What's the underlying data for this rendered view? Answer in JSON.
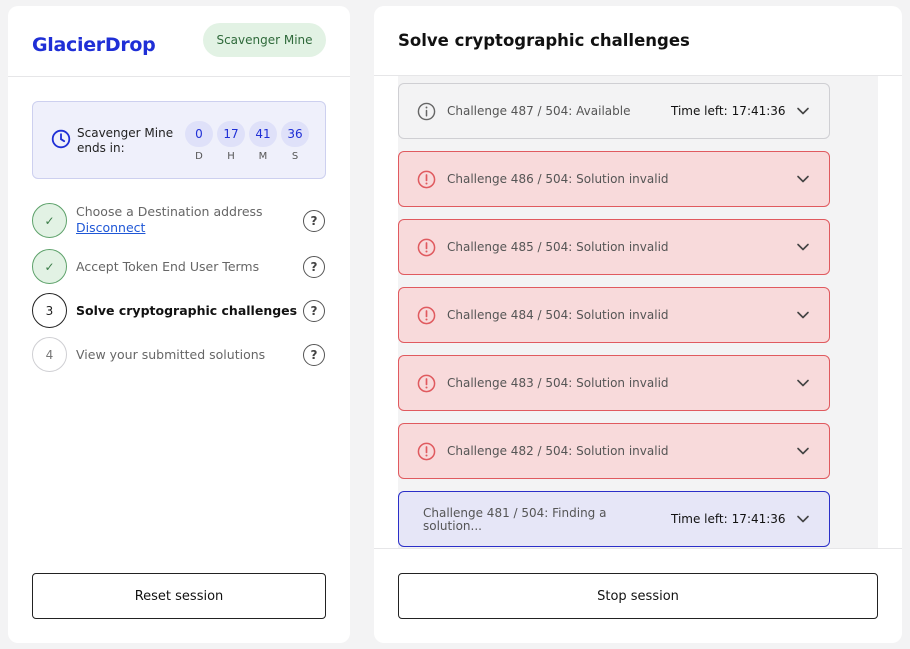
{
  "app": {
    "logo": "GlacierDrop",
    "badge": "Scavenger Mine"
  },
  "timer": {
    "label": "Scavenger Mine ends in:",
    "units": [
      {
        "value": "0",
        "unit": "D"
      },
      {
        "value": "17",
        "unit": "H"
      },
      {
        "value": "41",
        "unit": "M"
      },
      {
        "value": "36",
        "unit": "S"
      }
    ]
  },
  "steps": [
    {
      "number": "",
      "label": "Choose a Destination address",
      "link": "Disconnect",
      "status": "done"
    },
    {
      "number": "",
      "label": "Accept Token End User Terms",
      "status": "done"
    },
    {
      "number": "3",
      "label": "Solve cryptographic challenges",
      "status": "active"
    },
    {
      "number": "4",
      "label": "View your submitted solutions",
      "status": "todo"
    }
  ],
  "help_glyph": "?",
  "check_glyph": "✓",
  "reset_label": "Reset session",
  "main": {
    "title": "Solve cryptographic challenges",
    "time_left_label": "Time left:",
    "challenges": [
      {
        "label": "Challenge 487 / 504: Available",
        "status": "available",
        "time_left": "17:41:36"
      },
      {
        "label": "Challenge 486 / 504: Solution invalid",
        "status": "invalid"
      },
      {
        "label": "Challenge 485 / 504: Solution invalid",
        "status": "invalid"
      },
      {
        "label": "Challenge 484 / 504: Solution invalid",
        "status": "invalid"
      },
      {
        "label": "Challenge 483 / 504: Solution invalid",
        "status": "invalid"
      },
      {
        "label": "Challenge 482 / 504: Solution invalid",
        "status": "invalid"
      },
      {
        "label": "Challenge 481 / 504: Finding a solution...",
        "status": "finding",
        "time_left": "17:41:36"
      }
    ],
    "stop_label": "Stop session"
  },
  "colors": {
    "brand": "#1f2fd6",
    "success_bg": "#e2f2e4",
    "error_bg": "#f8dadb",
    "error_border": "#e05a5f",
    "active_border": "#2b2fc8"
  }
}
